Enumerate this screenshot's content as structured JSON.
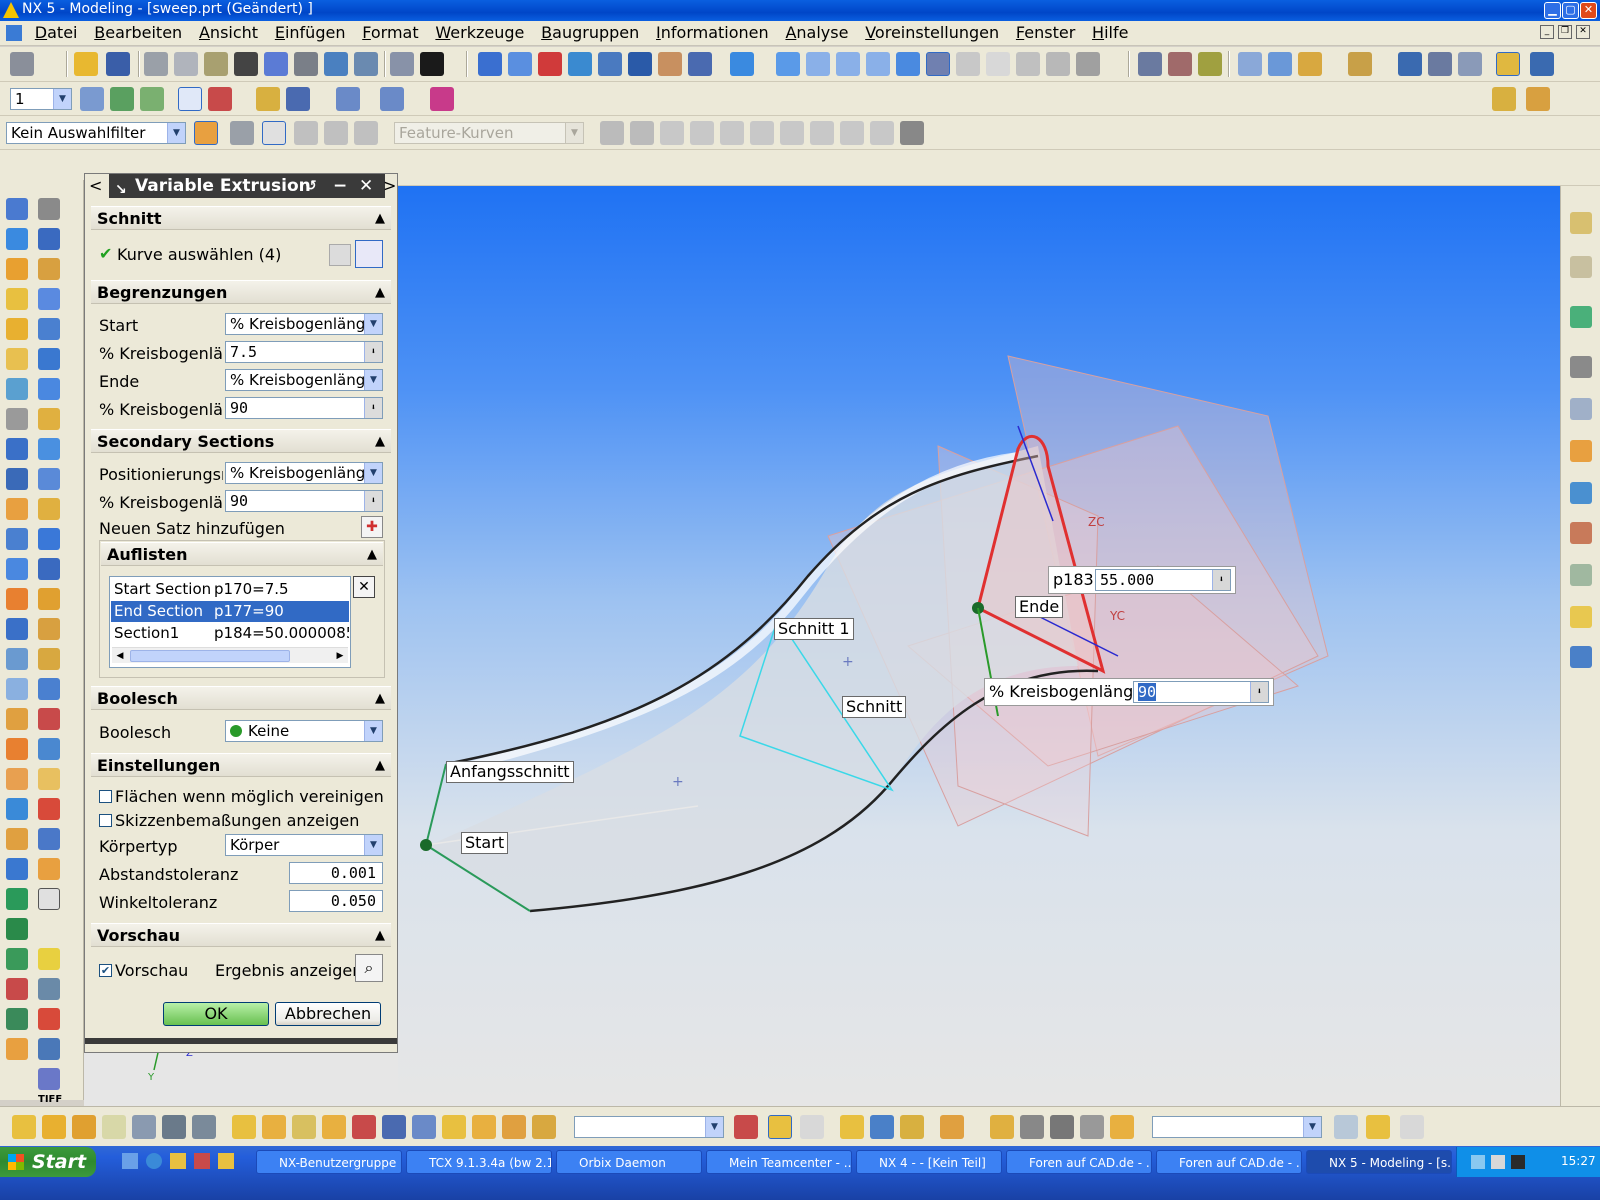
{
  "window": {
    "title": "NX 5 - Modeling - [sweep.prt (Geändert) ]"
  },
  "menu": [
    "Datei",
    "Bearbeiten",
    "Ansicht",
    "Einfügen",
    "Format",
    "Werkzeuge",
    "Baugruppen",
    "Informationen",
    "Analyse",
    "Voreinstellungen",
    "Fenster",
    "Hilfe"
  ],
  "toolbar": {
    "layer_value": "1",
    "selection_filter": "Kein Auswahlfilter",
    "curve_rule": "Feature-Kurven"
  },
  "dialog": {
    "title": "Variable Extrusion",
    "sections": {
      "schnitt": "Schnitt",
      "begrenzungen": "Begrenzungen",
      "secondary": "Secondary Sections",
      "auflisten": "Auflisten",
      "boolesch": "Boolesch",
      "einstellungen": "Einstellungen",
      "vorschau": "Vorschau"
    },
    "select_curve": "Kurve auswählen (4)",
    "start_label": "Start",
    "start_value": "% Kreisbogenlänge",
    "start_pct_label": "% Kreisbogenlänge",
    "start_pct_value": "7.5",
    "end_label": "Ende",
    "end_value": "% Kreisbogenlänge",
    "end_pct_label": "% Kreisbogenlänge",
    "end_pct_value": "90",
    "positioning_label": "Positionierungsmethode",
    "positioning_value": "% Kreisbogenlänge",
    "sec_pct_label": "% Kreisbogenlänge",
    "sec_pct_value": "90",
    "add_set_label": "Neuen Satz hinzufügen",
    "list_rows": [
      {
        "name": "Start Section",
        "value": "p170=7.5"
      },
      {
        "name": "End Section",
        "value": "p177=90"
      },
      {
        "name": "Section1",
        "value": "p184=50.0000085"
      }
    ],
    "boolean_label": "Boolesch",
    "boolean_value": "Keine",
    "merge_faces": "Flächen wenn möglich vereinigen",
    "show_sketch_dims": "Skizzenbemaßungen anzeigen",
    "body_type_label": "Körpertyp",
    "body_type_value": "Körper",
    "dist_tol_label": "Abstandstoleranz",
    "dist_tol_value": "0.001",
    "angle_tol_label": "Winkeltoleranz",
    "angle_tol_value": "0.050",
    "preview_label": "Vorschau",
    "show_result_label": "Ergebnis anzeigen",
    "ok": "OK",
    "cancel": "Abbrechen"
  },
  "viewport": {
    "labels": {
      "anfangsschnitt": "Anfangsschnitt",
      "start": "Start",
      "schnitt1": "Schnitt 1",
      "schnitt": "Schnitt",
      "ende": "Ende",
      "zc": "ZC",
      "yc": "YC",
      "z": "Z",
      "y": "Y"
    },
    "p183_label": "p183",
    "p183_value": "55.000",
    "arc_label": "% Kreisbogenlänge",
    "arc_value": "90"
  },
  "left_strip": {
    "tiff_label": "TIFF"
  },
  "taskbar": {
    "start": "Start",
    "tasks": [
      "NX-Benutzergruppe ...",
      "TCX 9.1.3.4a (bw 2.1)",
      "Orbix Daemon",
      "Mein Teamcenter - ...",
      "NX 4 - - [Kein Teil]",
      "Foren auf CAD.de - ...",
      "Foren auf CAD.de - ...",
      "NX 5 - Modeling - [s..."
    ],
    "clock": "15:27"
  },
  "colors": {
    "selection": "#316ac5",
    "profile_red": "#e03030",
    "title_blue": "#0a5fe0"
  }
}
